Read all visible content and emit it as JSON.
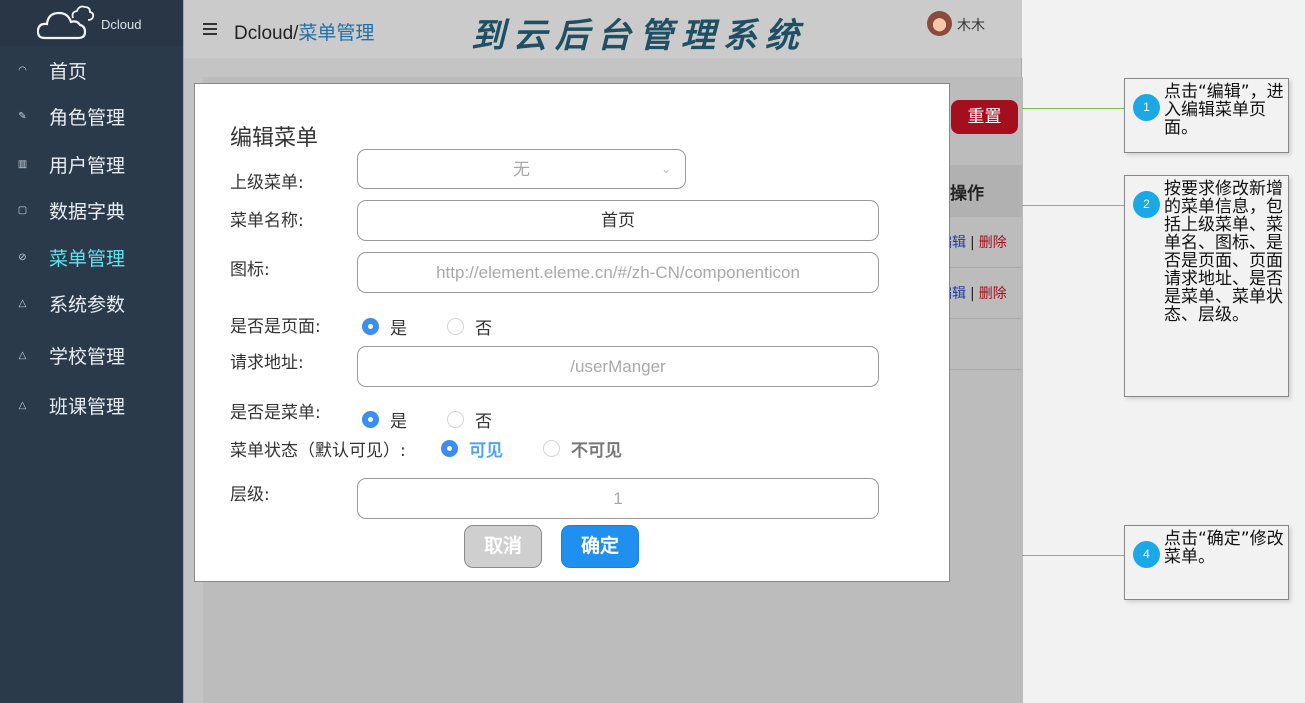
{
  "sidebar": {
    "logo_text": "Dcloud",
    "items": [
      {
        "label": "首页",
        "icon": "◠"
      },
      {
        "label": "角色管理",
        "icon": "✎"
      },
      {
        "label": "用户管理",
        "icon": "▥"
      },
      {
        "label": "数据字典",
        "icon": "▢"
      },
      {
        "label": "菜单管理",
        "icon": "⊘"
      },
      {
        "label": "系统参数",
        "icon": "△"
      },
      {
        "label": "学校管理",
        "icon": "△"
      },
      {
        "label": "班课管理",
        "icon": "△"
      }
    ]
  },
  "header": {
    "breadcrumb_root": "Dcloud/",
    "breadcrumb_current": "菜单管理",
    "system_title": "到云后台管理系统",
    "user_name": "木木"
  },
  "background": {
    "reset_label": "重置",
    "ops_header": "操作",
    "rows": [
      {
        "edit": "编辑",
        "sep": "|",
        "delete": "删除"
      },
      {
        "edit": "编辑",
        "sep": "|",
        "delete": "删除"
      }
    ]
  },
  "modal": {
    "title": "编辑菜单",
    "parent_label": "上级菜单:",
    "parent_value": "无",
    "name_label": "菜单名称:",
    "name_value": "首页",
    "icon_label": "图标:",
    "icon_placeholder": "http://element.eleme.cn/#/zh-CN/componenticon",
    "is_page_label": "是否是页面:",
    "is_page_yes": "是",
    "is_page_no": "否",
    "request_label": "请求地址:",
    "request_placeholder": "/userManger",
    "is_menu_label": "是否是菜单:",
    "is_menu_yes": "是",
    "is_menu_no": "否",
    "status_label": "菜单状态（默认可见）:",
    "status_visible": "可见",
    "status_hidden": "不可见",
    "level_label": "层级:",
    "level_placeholder": "1",
    "cancel_label": "取消",
    "ok_label": "确定"
  },
  "annotations": [
    {
      "badge": "1",
      "text": "点击“编辑”，进入编辑菜单页面。"
    },
    {
      "badge": "2",
      "text": "按要求修改新增的菜单信息，包括上级菜单、菜单名、图标、是否是页面、页面请求地址、是否是菜单、菜单状态、层级。"
    },
    {
      "badge": "4",
      "text": "点击“确定”修改菜单。"
    }
  ]
}
